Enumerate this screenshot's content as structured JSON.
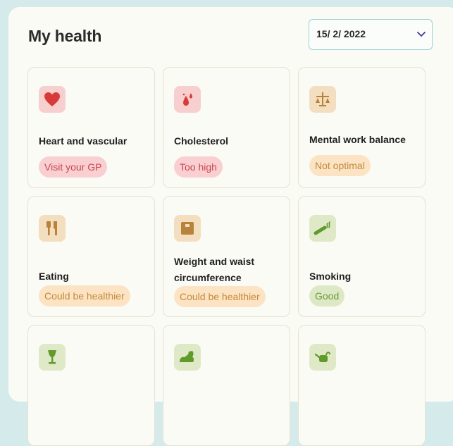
{
  "header": {
    "title": "My health",
    "date_value": "15/ 2/ 2022"
  },
  "cards": [
    {
      "title": "Heart and vascular",
      "status": "Visit your GP",
      "status_color": "red",
      "icon": "heart-icon"
    },
    {
      "title": "Cholesterol",
      "status": "Too high",
      "status_color": "red",
      "icon": "blood-drops-icon"
    },
    {
      "title": "Mental work balance",
      "status": "Not optimal",
      "status_color": "orange",
      "icon": "balance-scale-icon"
    },
    {
      "title": "Eating",
      "status": "Could be healthier",
      "status_color": "orange",
      "icon": "fork-knife-icon"
    },
    {
      "title": "Weight and waist circumference",
      "status": "Could be healthier",
      "status_color": "orange",
      "icon": "scale-icon"
    },
    {
      "title": "Smoking",
      "status": "Good",
      "status_color": "green",
      "icon": "cigarette-icon"
    },
    {
      "icon": "wine-glass-icon"
    },
    {
      "icon": "flexed-arm-icon"
    },
    {
      "icon": "watering-can-icon"
    }
  ],
  "colors": {
    "red_icon": "#d83a3a",
    "orange_icon": "#b9823a",
    "green_icon": "#5f9a2a"
  }
}
